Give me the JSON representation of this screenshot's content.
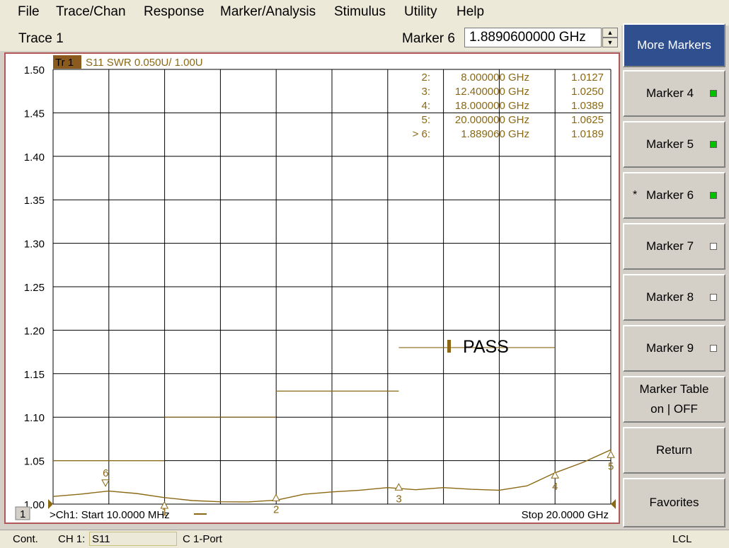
{
  "menu": {
    "items": [
      "File",
      "Trace/Chan",
      "Response",
      "Marker/Analysis",
      "Stimulus",
      "Utility",
      "Help"
    ]
  },
  "trace_row": {
    "title": "Trace 1",
    "marker_label": "Marker 6",
    "marker_value": "1.8890600000 GHz",
    "spin_up": "▲",
    "spin_down": "▼"
  },
  "softkeys": {
    "more_markers": "More Markers",
    "marker4": "Marker 4",
    "marker5": "Marker 5",
    "marker6": "Marker 6",
    "marker6_star": "*",
    "marker7": "Marker 7",
    "marker8": "Marker 8",
    "marker9": "Marker 9",
    "marker_table_line1": "Marker Table",
    "marker_table_line2": "on | OFF",
    "return": "Return",
    "favorites": "Favorites"
  },
  "status": {
    "mode": "Cont.",
    "channel": "CH 1:",
    "param": "S11",
    "cal": "C  1-Port",
    "lcl": "LCL"
  },
  "colors": {
    "trace": "#8b6914",
    "grid": "#000000",
    "frame": "#b05858",
    "led_on": "#00c000",
    "accent": "#2f4f8f"
  },
  "chart_data": {
    "type": "line",
    "trace_badge": "Tr  1",
    "header": "S11 SWR 0.050U/  1.00U",
    "y_ticks": [
      "1.50",
      "1.45",
      "1.40",
      "1.35",
      "1.30",
      "1.25",
      "1.20",
      "1.15",
      "1.10",
      "1.05",
      "1.00"
    ],
    "ylim": [
      1.0,
      1.5
    ],
    "xlim_ghz": [
      0.01,
      20.0
    ],
    "start_label": ">Ch1: Start  10.0000 MHz",
    "stop_label": "Stop  20.0000 GHz",
    "channel_num": "1",
    "series": [
      {
        "x_ghz": [
          0.01,
          1.0,
          2.0,
          3.0,
          4.0,
          5.0,
          6.0,
          7.0,
          8.0,
          9.0,
          10.0,
          11.0,
          12.0,
          13.0,
          14.0,
          15.0,
          16.0,
          17.0,
          18.0,
          19.0,
          20.0
        ],
        "y": [
          1.0088,
          1.0115,
          1.015,
          1.0122,
          1.0075,
          1.0041,
          1.0027,
          1.0025,
          1.0045,
          1.0113,
          1.014,
          1.016,
          1.019,
          1.0165,
          1.019,
          1.017,
          1.016,
          1.021,
          1.036,
          1.048,
          1.0625
        ]
      }
    ],
    "limit_segments": [
      {
        "x_ghz": [
          0.01,
          4.0
        ],
        "y": 1.05
      },
      {
        "x_ghz": [
          4.0,
          8.0
        ],
        "y": 1.1
      },
      {
        "x_ghz": [
          8.0,
          12.4
        ],
        "y": 1.13
      },
      {
        "x_ghz": [
          12.4,
          18.0
        ],
        "y": 1.18
      }
    ],
    "limit_result": "PASS",
    "markers": [
      {
        "id": "1",
        "x_ghz": 4.0,
        "y": 1.0041,
        "dir": "up"
      },
      {
        "id": "2",
        "x_ghz": 8.0,
        "y": 1.0127,
        "dir": "up"
      },
      {
        "id": "3",
        "x_ghz": 12.4,
        "y": 1.025,
        "dir": "up"
      },
      {
        "id": "4",
        "x_ghz": 18.0,
        "y": 1.0389,
        "dir": "up"
      },
      {
        "id": "5",
        "x_ghz": 20.0,
        "y": 1.0625,
        "dir": "up"
      },
      {
        "id": "6",
        "x_ghz": 1.889,
        "y": 1.0189,
        "dir": "down"
      }
    ],
    "marker_readout": [
      {
        "label": "2:",
        "freq": "8.000000 GHz",
        "value": "1.0127"
      },
      {
        "label": "3:",
        "freq": "12.400000 GHz",
        "value": "1.0250"
      },
      {
        "label": "4:",
        "freq": "18.000000 GHz",
        "value": "1.0389"
      },
      {
        "label": "5:",
        "freq": "20.000000 GHz",
        "value": "1.0625"
      },
      {
        "label": "> 6:",
        "freq": "1.889060 GHz",
        "value": "1.0189"
      }
    ]
  }
}
